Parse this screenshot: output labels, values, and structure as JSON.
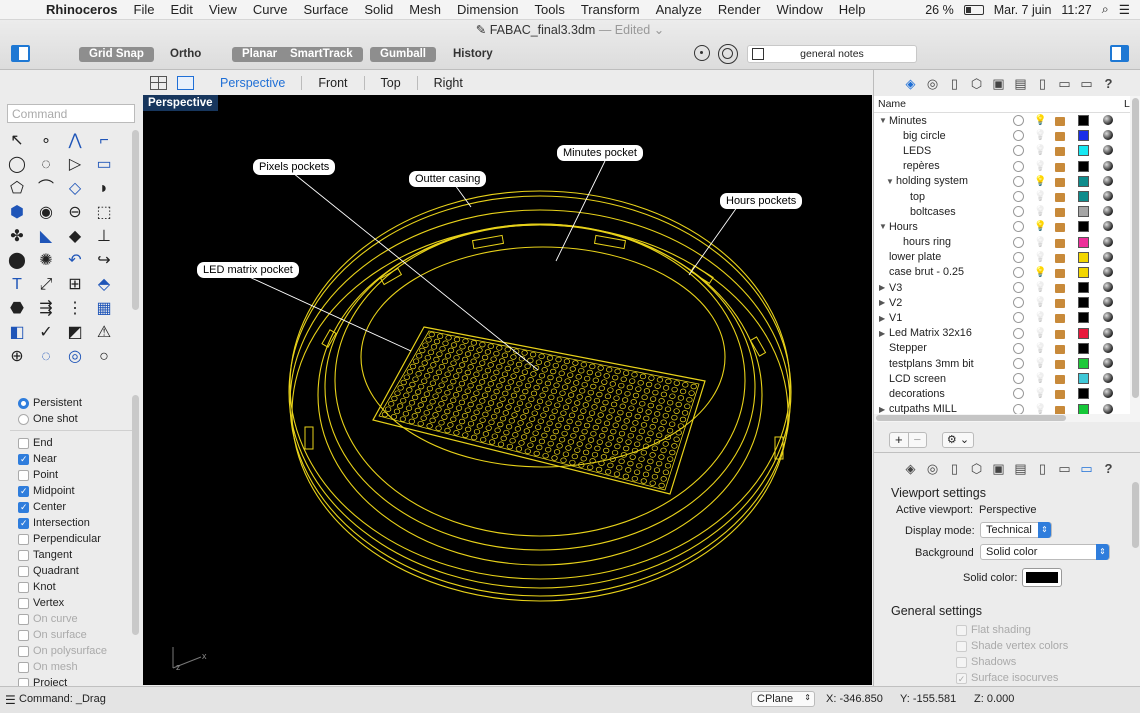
{
  "menubar": {
    "app": "Rhinoceros",
    "items": [
      "File",
      "Edit",
      "View",
      "Curve",
      "Surface",
      "Solid",
      "Mesh",
      "Dimension",
      "Tools",
      "Transform",
      "Analyze",
      "Render",
      "Window",
      "Help"
    ],
    "battery": "26 %",
    "date": "Mar. 7 juin",
    "time": "11:27"
  },
  "window": {
    "filename": "FABAC_final3.3dm",
    "edited": "— Edited"
  },
  "toolbar": {
    "toggles": [
      {
        "label": "Grid Snap",
        "on": true
      },
      {
        "label": "Ortho",
        "on": false
      },
      {
        "label": "Planar",
        "on": true
      },
      {
        "label": "SmartTrack",
        "on": true
      },
      {
        "label": "Gumball",
        "on": true
      },
      {
        "label": "History",
        "on": false
      }
    ],
    "notes": "general notes"
  },
  "command": {
    "placeholder": "Command",
    "status": "Command: _Drag"
  },
  "osnap": {
    "modes": [
      {
        "label": "Persistent",
        "on": true
      },
      {
        "label": "One shot",
        "on": false
      }
    ],
    "items": [
      {
        "label": "End",
        "on": false,
        "dim": false
      },
      {
        "label": "Near",
        "on": true,
        "dim": false
      },
      {
        "label": "Point",
        "on": false,
        "dim": false
      },
      {
        "label": "Midpoint",
        "on": true,
        "dim": false
      },
      {
        "label": "Center",
        "on": true,
        "dim": false
      },
      {
        "label": "Intersection",
        "on": true,
        "dim": false
      },
      {
        "label": "Perpendicular",
        "on": false,
        "dim": false
      },
      {
        "label": "Tangent",
        "on": false,
        "dim": false
      },
      {
        "label": "Quadrant",
        "on": false,
        "dim": false
      },
      {
        "label": "Knot",
        "on": false,
        "dim": false
      },
      {
        "label": "Vertex",
        "on": false,
        "dim": false
      },
      {
        "label": "On curve",
        "on": false,
        "dim": true
      },
      {
        "label": "On surface",
        "on": false,
        "dim": true
      },
      {
        "label": "On polysurface",
        "on": false,
        "dim": true
      },
      {
        "label": "On mesh",
        "on": false,
        "dim": true
      },
      {
        "label": "Project",
        "on": false,
        "dim": false
      }
    ]
  },
  "viewport": {
    "tabs": [
      "Perspective",
      "Front",
      "Top",
      "Right"
    ],
    "active": "Perspective",
    "label": "Perspective",
    "accent": "#e8d21a",
    "callouts": {
      "pixels": "Pixels pockets",
      "minutes": "Minutes pocket",
      "casing": "Outter casing",
      "hours": "Hours pockets",
      "led": "LED matrix pocket"
    },
    "axis_x": "x",
    "axis_z": "z"
  },
  "statusbar": {
    "cplane": "CPlane",
    "x": "X: -346.850",
    "y": "Y: -155.581",
    "z": "Z: 0.000"
  },
  "layers": {
    "header": "Name",
    "header_l": "L",
    "rows": [
      {
        "name": "Minutes",
        "indent": 0,
        "tri": "▼",
        "color": "#000000",
        "bulb": true
      },
      {
        "name": "big circle",
        "indent": 2,
        "tri": "",
        "color": "#1a2ee8",
        "bulb": false
      },
      {
        "name": "LEDS",
        "indent": 2,
        "tri": "",
        "color": "#16e8f2",
        "bulb": false
      },
      {
        "name": "repères",
        "indent": 2,
        "tri": "",
        "color": "#000000",
        "bulb": false
      },
      {
        "name": "holding system",
        "indent": 1,
        "tri": "▼",
        "color": "#0e8c8c",
        "bulb": true
      },
      {
        "name": "top",
        "indent": 3,
        "tri": "",
        "color": "#0e8c8c",
        "bulb": false
      },
      {
        "name": "boltcases",
        "indent": 3,
        "tri": "",
        "color": "#a6a6a6",
        "bulb": false
      },
      {
        "name": "Hours",
        "indent": 0,
        "tri": "▼",
        "color": "#000000",
        "bulb": true
      },
      {
        "name": "hours ring",
        "indent": 2,
        "tri": "",
        "color": "#ec2f9a",
        "bulb": false
      },
      {
        "name": "lower plate",
        "indent": 0,
        "tri": "",
        "color": "#f2d600",
        "bulb": false
      },
      {
        "name": "case brut - 0.25",
        "indent": 0,
        "tri": "",
        "color": "#f2d600",
        "bulb": true
      },
      {
        "name": "V3",
        "indent": 0,
        "tri": "▶",
        "color": "#000000",
        "bulb": false
      },
      {
        "name": "V2",
        "indent": 0,
        "tri": "▶",
        "color": "#000000",
        "bulb": false
      },
      {
        "name": "V1",
        "indent": 0,
        "tri": "▶",
        "color": "#000000",
        "bulb": false
      },
      {
        "name": "Led Matrix 32x16",
        "indent": 0,
        "tri": "▶",
        "color": "#e8193c",
        "bulb": false
      },
      {
        "name": "Stepper",
        "indent": 0,
        "tri": "",
        "color": "#000000",
        "bulb": false
      },
      {
        "name": "testplans 3mm bit",
        "indent": 0,
        "tri": "",
        "color": "#1ec93a",
        "bulb": false
      },
      {
        "name": "LCD screen",
        "indent": 0,
        "tri": "",
        "color": "#3fc8d8",
        "bulb": false
      },
      {
        "name": "decorations",
        "indent": 0,
        "tri": "",
        "color": "#000000",
        "bulb": false
      },
      {
        "name": "cutpaths MILL",
        "indent": 0,
        "tri": "▶",
        "color": "#15c838",
        "bulb": false
      }
    ]
  },
  "viewport_settings": {
    "title": "Viewport settings",
    "active_label": "Active viewport:",
    "active_value": "Perspective",
    "display_label": "Display mode:",
    "display_value": "Technical",
    "bg_label": "Background",
    "bg_value": "Solid color",
    "solid_label": "Solid color:",
    "solid_color": "#000000",
    "general_title": "General settings",
    "general": [
      {
        "label": "Flat shading",
        "on": false
      },
      {
        "label": "Shade vertex colors",
        "on": false
      },
      {
        "label": "Shadows",
        "on": false
      },
      {
        "label": "Surface isocurves",
        "on": true
      }
    ]
  }
}
